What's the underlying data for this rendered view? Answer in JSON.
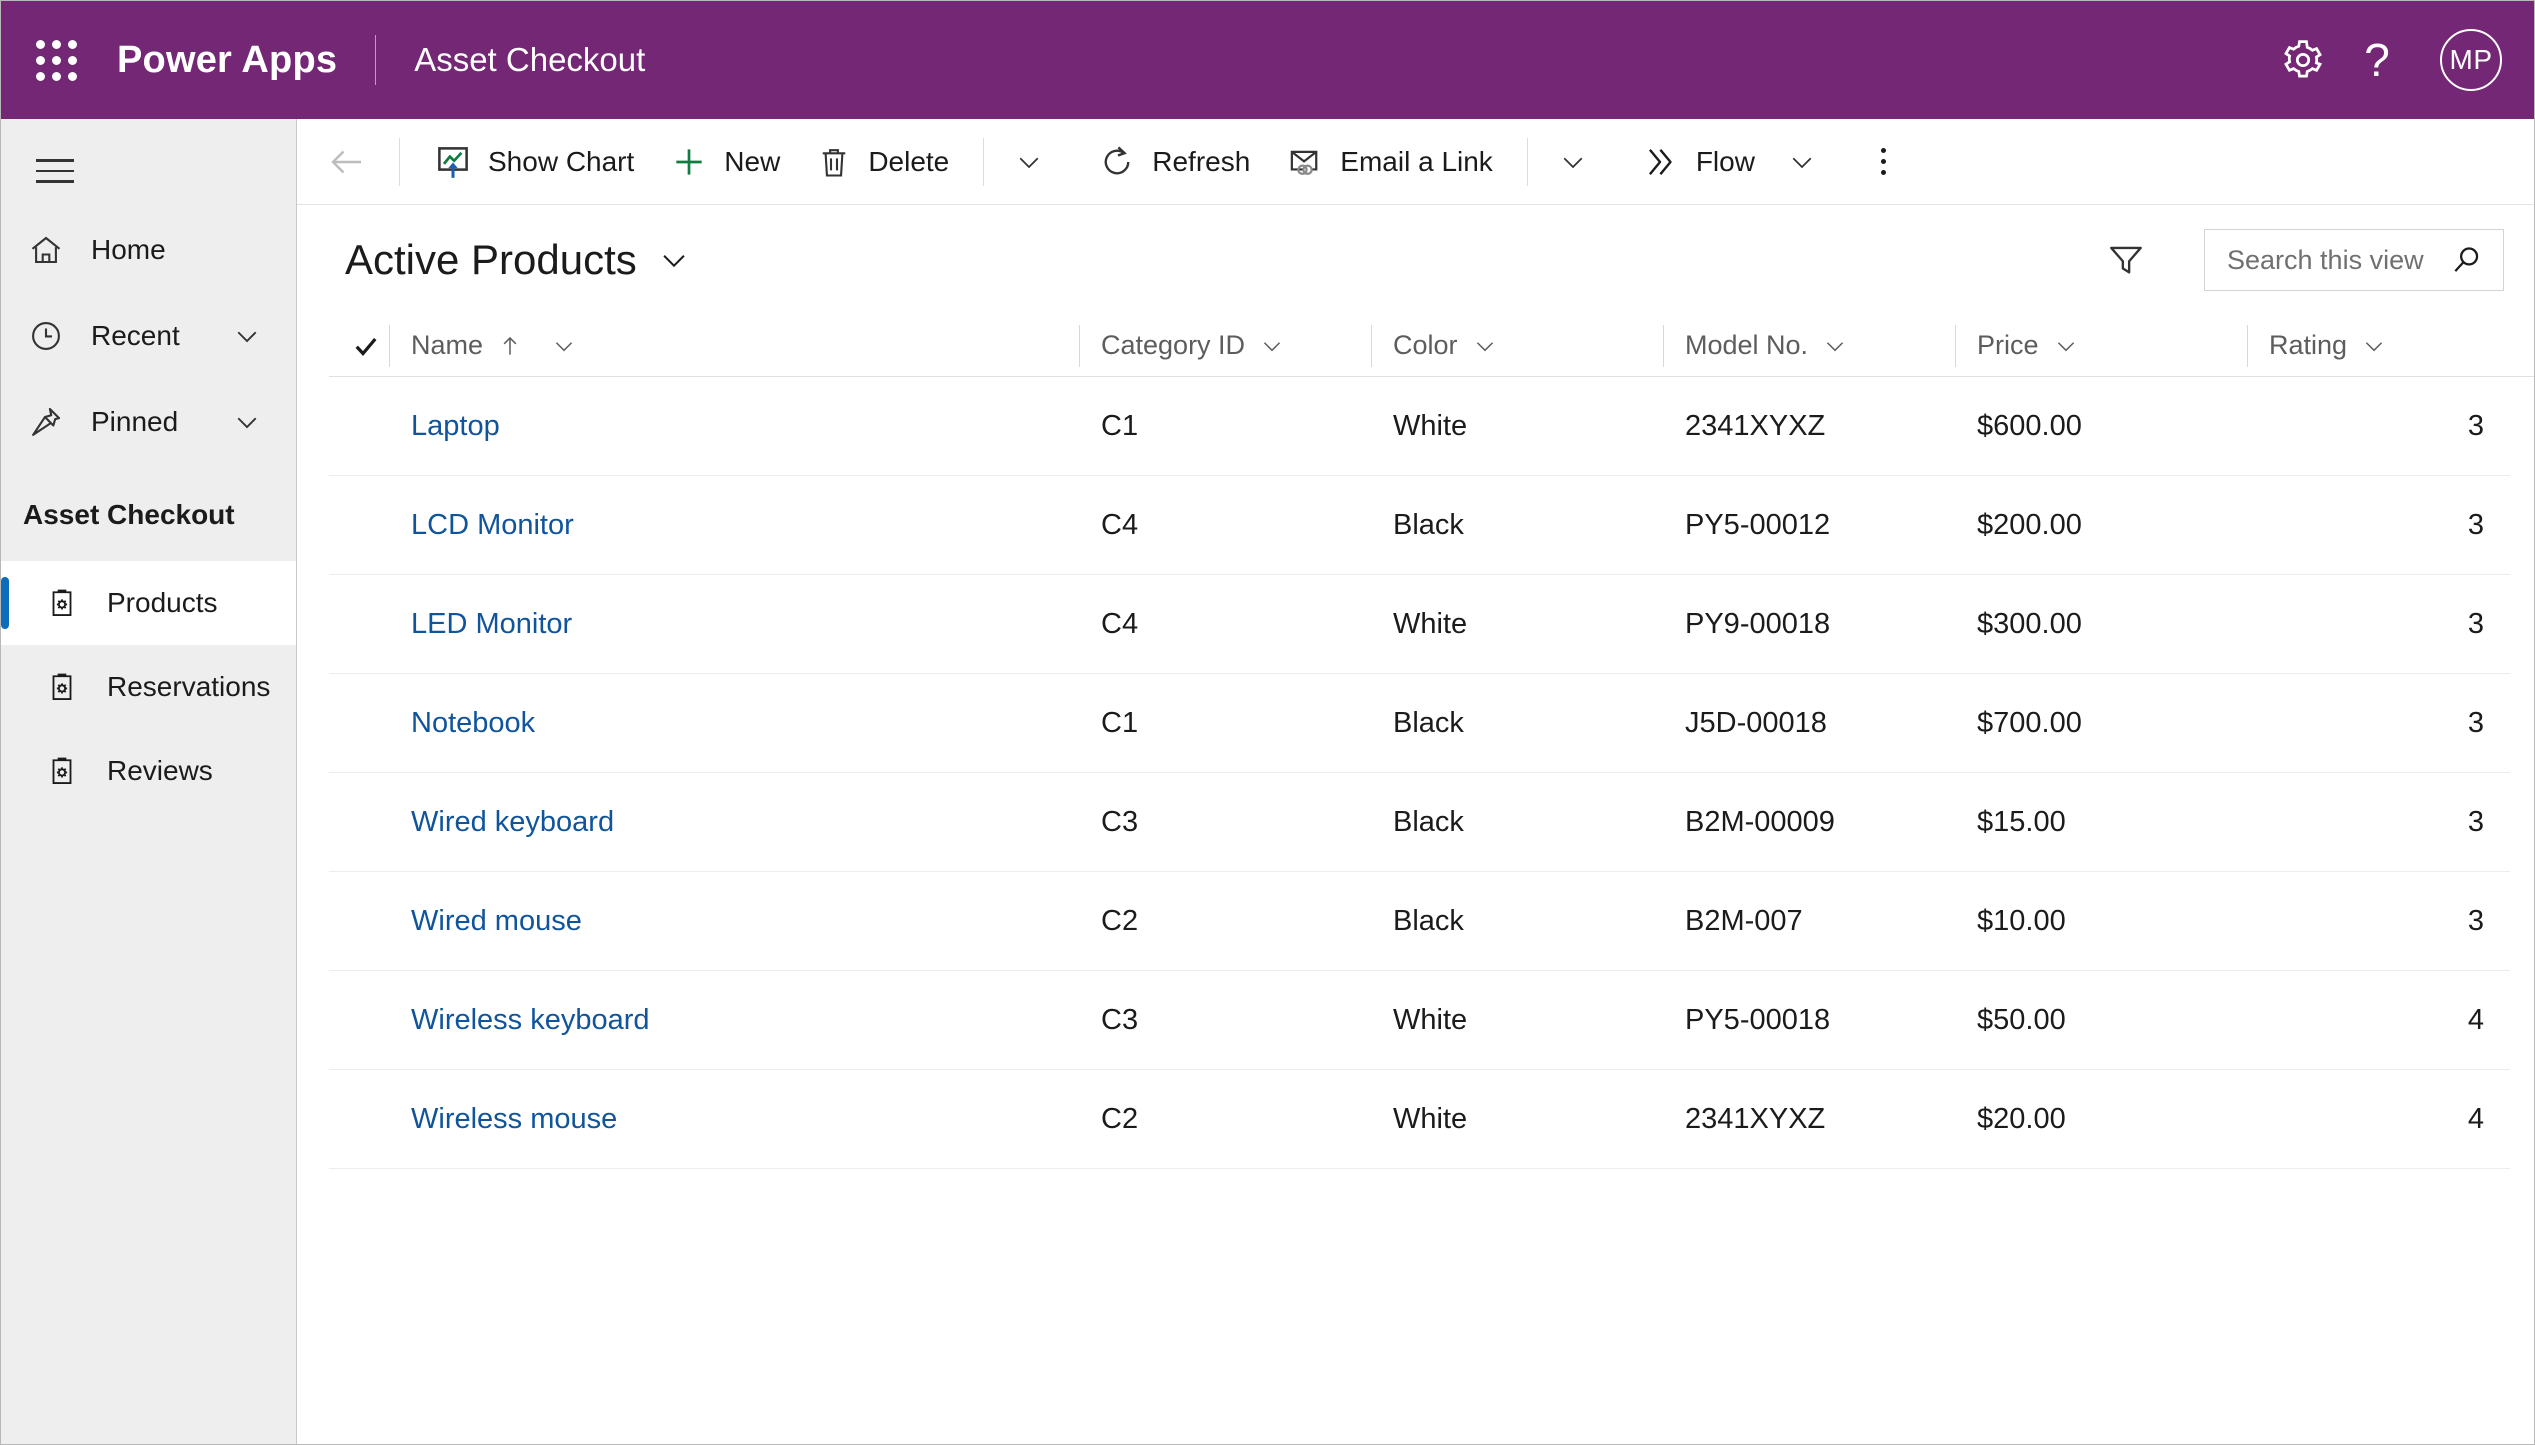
{
  "header": {
    "waffle_label": "app-launcher",
    "brand": "Power Apps",
    "app_name": "Asset Checkout",
    "settings_label": "Settings",
    "help_label": "?",
    "avatar_initials": "MP",
    "brand_color": "#742774"
  },
  "sidebar": {
    "menu_label": "Site map",
    "items": [
      {
        "label": "Home",
        "icon": "home-icon",
        "has_chevron": false
      },
      {
        "label": "Recent",
        "icon": "clock-icon",
        "has_chevron": true
      },
      {
        "label": "Pinned",
        "icon": "pin-icon",
        "has_chevron": true
      }
    ],
    "group_header": "Asset Checkout",
    "entities": [
      {
        "label": "Products",
        "icon": "entity-icon",
        "selected": true
      },
      {
        "label": "Reservations",
        "icon": "entity-icon",
        "selected": false
      },
      {
        "label": "Reviews",
        "icon": "entity-icon",
        "selected": false
      }
    ],
    "accent_color": "#0f6cbd"
  },
  "command_bar": {
    "back_label": "Back",
    "buttons": [
      {
        "label": "Show Chart",
        "icon": "show-chart-icon"
      },
      {
        "label": "New",
        "icon": "plus-icon"
      },
      {
        "label": "Delete",
        "icon": "trash-icon"
      },
      {
        "label": "Refresh",
        "icon": "refresh-icon"
      },
      {
        "label": "Email a Link",
        "icon": "email-link-icon"
      },
      {
        "label": "Flow",
        "icon": "flow-icon"
      }
    ],
    "overflow_label": "More commands"
  },
  "view": {
    "title": "Active Products",
    "filter_label": "Filter",
    "search": {
      "placeholder": "Search this view",
      "value": ""
    }
  },
  "grid": {
    "select_all_label": "Select all",
    "columns": [
      {
        "key": "name",
        "label": "Name",
        "sorted": "asc"
      },
      {
        "key": "category",
        "label": "Category ID",
        "sorted": ""
      },
      {
        "key": "color",
        "label": "Color",
        "sorted": ""
      },
      {
        "key": "model",
        "label": "Model No.",
        "sorted": ""
      },
      {
        "key": "price",
        "label": "Price",
        "sorted": ""
      },
      {
        "key": "rating",
        "label": "Rating",
        "sorted": ""
      }
    ],
    "rows": [
      {
        "name": "Laptop",
        "category": "C1",
        "color": "White",
        "model": "2341XYXZ",
        "price": "$600.00",
        "rating": "3"
      },
      {
        "name": "LCD Monitor",
        "category": "C4",
        "color": "Black",
        "model": "PY5-00012",
        "price": "$200.00",
        "rating": "3"
      },
      {
        "name": "LED Monitor",
        "category": "C4",
        "color": "White",
        "model": "PY9-00018",
        "price": "$300.00",
        "rating": "3"
      },
      {
        "name": "Notebook",
        "category": "C1",
        "color": "Black",
        "model": "J5D-00018",
        "price": "$700.00",
        "rating": "3"
      },
      {
        "name": "Wired keyboard",
        "category": "C3",
        "color": "Black",
        "model": "B2M-00009",
        "price": "$15.00",
        "rating": "3"
      },
      {
        "name": "Wired mouse",
        "category": "C2",
        "color": "Black",
        "model": "B2M-007",
        "price": "$10.00",
        "rating": "3"
      },
      {
        "name": "Wireless keyboard",
        "category": "C3",
        "color": "White",
        "model": "PY5-00018",
        "price": "$50.00",
        "rating": "4"
      },
      {
        "name": "Wireless mouse",
        "category": "C2",
        "color": "White",
        "model": "2341XYXZ",
        "price": "$20.00",
        "rating": "4"
      }
    ],
    "link_color": "#10549b"
  }
}
